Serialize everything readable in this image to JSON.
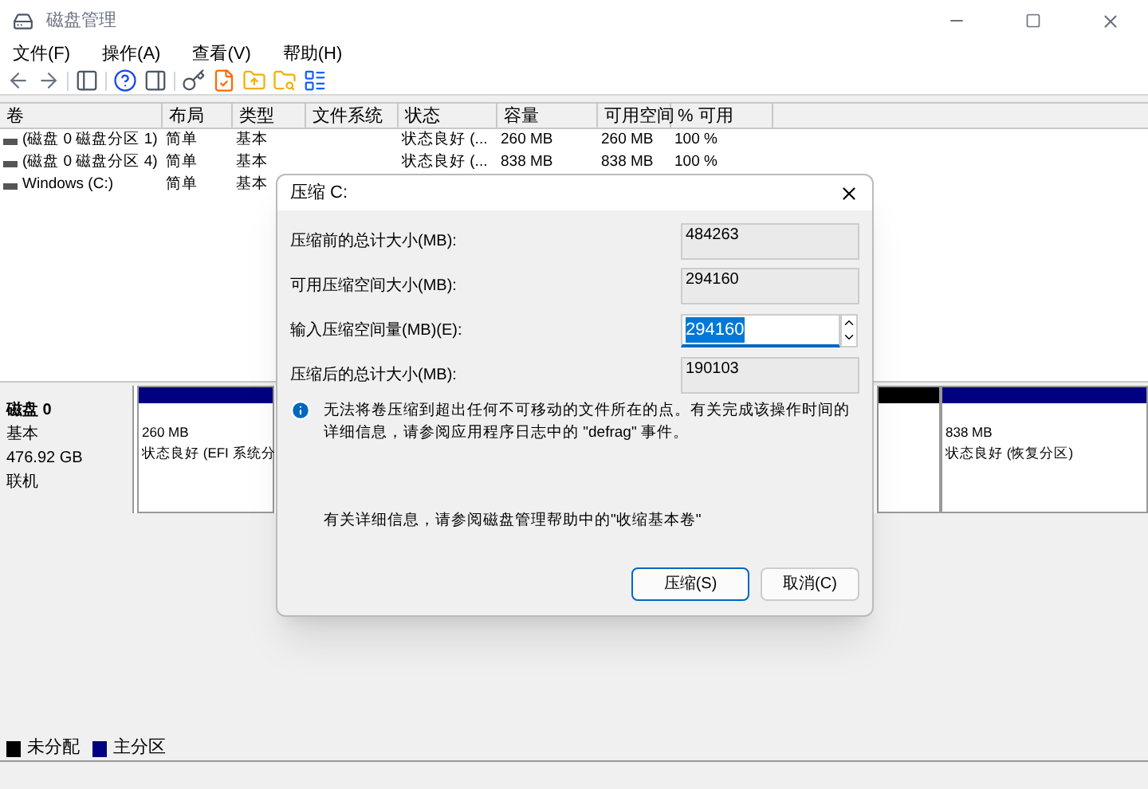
{
  "window": {
    "title": "磁盘管理"
  },
  "menu": [
    "文件(F)",
    "操作(A)",
    "查看(V)",
    "帮助(H)"
  ],
  "table": {
    "columns": [
      "卷",
      "布局",
      "类型",
      "文件系统",
      "状态",
      "容量",
      "可用空间",
      "% 可用"
    ],
    "rows": [
      {
        "cells": [
          "(磁盘 0 磁盘分区 1)",
          "简单",
          "基本",
          "",
          "状态良好 (...",
          "260 MB",
          "260 MB",
          "100 %"
        ]
      },
      {
        "cells": [
          "(磁盘 0 磁盘分区 4)",
          "简单",
          "基本",
          "",
          "状态良好 (...",
          "838 MB",
          "838 MB",
          "100 %"
        ]
      },
      {
        "cells": [
          "Windows (C:)",
          "简单",
          "基本"
        ]
      }
    ]
  },
  "disk": {
    "name": "磁盘 0",
    "type": "基本",
    "size": "476.92 GB",
    "status": "联机",
    "partitions": [
      {
        "kind": "primary",
        "size": "260 MB",
        "status": "状态良好 (EFI 系统分"
      },
      {
        "kind": "hidden"
      },
      {
        "kind": "unallocated"
      },
      {
        "kind": "primary",
        "size": "838 MB",
        "status": "状态良好 (恢复分区)"
      }
    ]
  },
  "legend": [
    {
      "label": "未分配",
      "color": "#000000"
    },
    {
      "label": "主分区",
      "color": "#000080"
    }
  ],
  "dialog": {
    "title": "压缩 C:",
    "fields": [
      {
        "kind": "readonly",
        "label": "压缩前的总计大小(MB):",
        "value": "484263"
      },
      {
        "kind": "readonly",
        "label": "可用压缩空间大小(MB):",
        "value": "294160"
      },
      {
        "kind": "spin",
        "label": "输入压缩空间量(MB)(E):",
        "value": "294160",
        "selected": true
      },
      {
        "kind": "readonly",
        "label": "压缩后的总计大小(MB):",
        "value": "190103"
      }
    ],
    "info": "无法将卷压缩到超出任何不可移动的文件所在的点。有关完成该操作时间的详细信息，请参阅应用程序日志中的 \"defrag\" 事件。",
    "help": "有关详细信息，请参阅磁盘管理帮助中的\"收缩基本卷\"",
    "buttons": [
      {
        "label": "压缩(S)",
        "default": true
      },
      {
        "label": "取消(C)",
        "default": false
      }
    ]
  }
}
